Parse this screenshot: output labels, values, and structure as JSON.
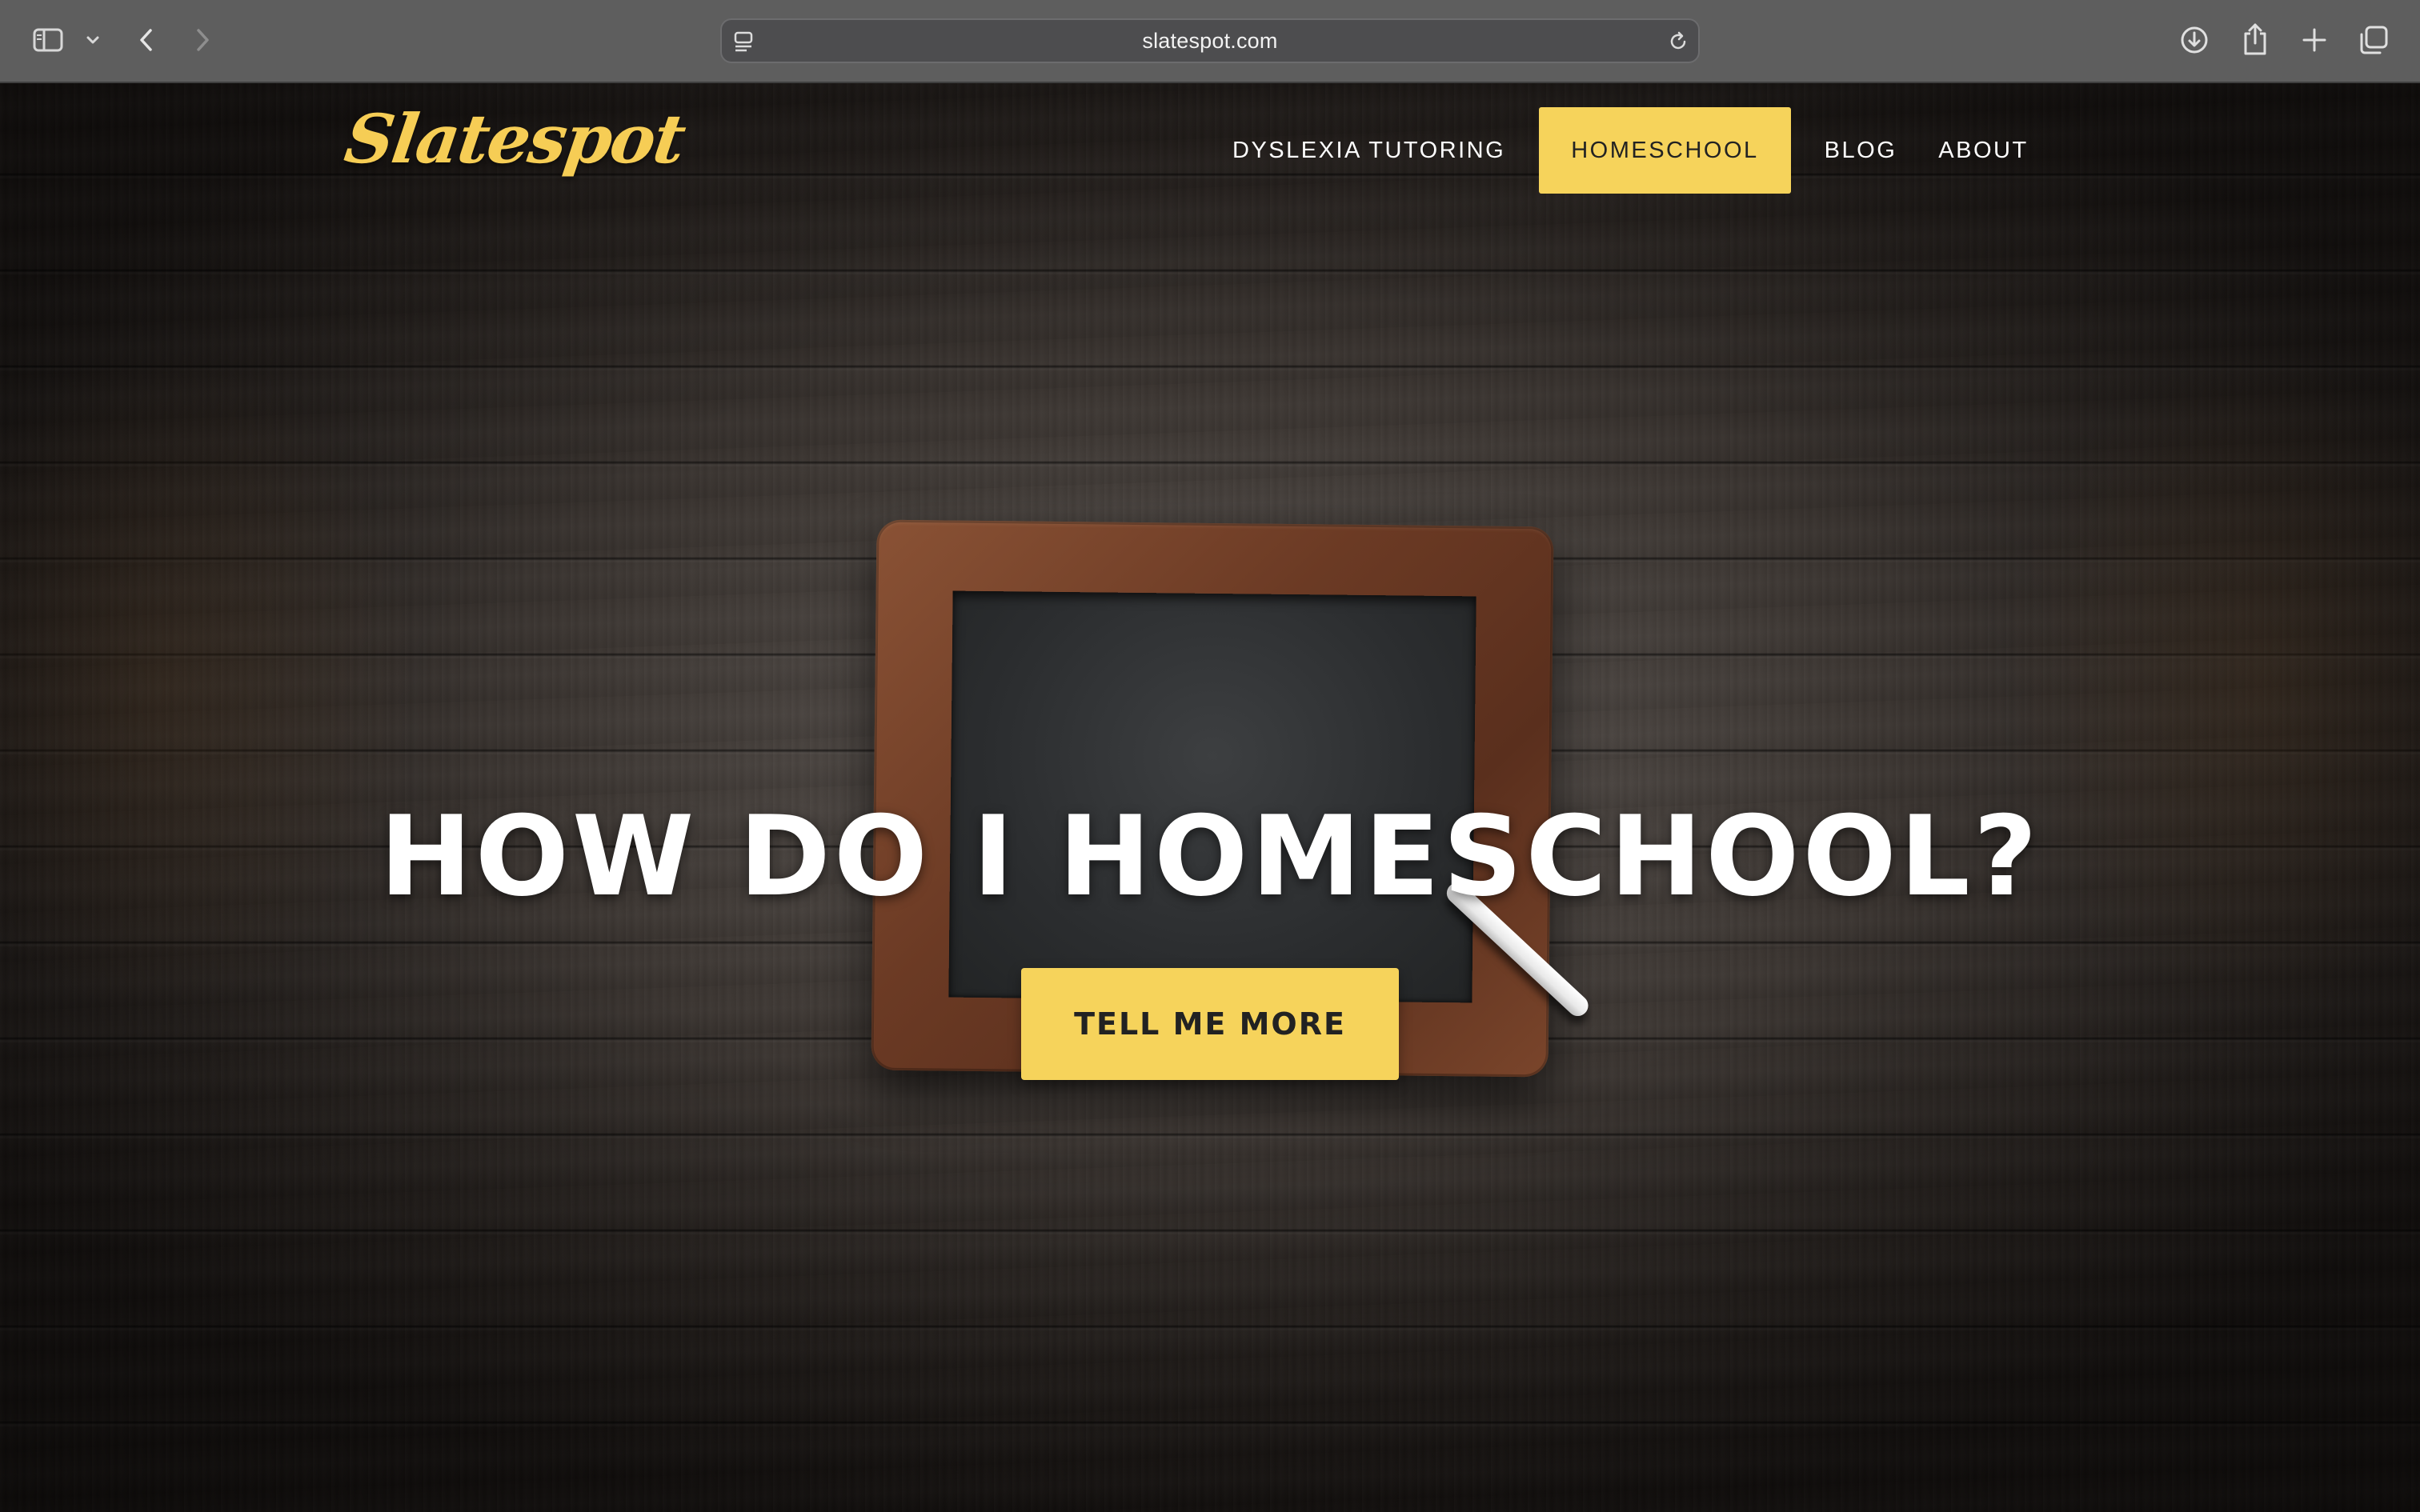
{
  "browser": {
    "url": "slatespot.com",
    "icons": [
      "sidebar-icon",
      "chevron-down-icon",
      "back-icon",
      "forward-icon",
      "page-menu-icon",
      "reload-icon",
      "download-icon",
      "share-icon",
      "new-tab-icon",
      "tab-overview-icon"
    ]
  },
  "site": {
    "logo": "Slatespot",
    "nav": [
      {
        "label": "DYSLEXIA TUTORING",
        "active": false
      },
      {
        "label": "HOMESCHOOL",
        "active": true
      },
      {
        "label": "BLOG",
        "active": false
      },
      {
        "label": "ABOUT",
        "active": false
      }
    ]
  },
  "hero": {
    "title": "HOW DO I HOMESCHOOL?",
    "cta_label": "TELL ME MORE"
  },
  "colors": {
    "accent": "#f6d35b",
    "logo": "#f6cd55",
    "toolbar": "#5e5e5e"
  }
}
